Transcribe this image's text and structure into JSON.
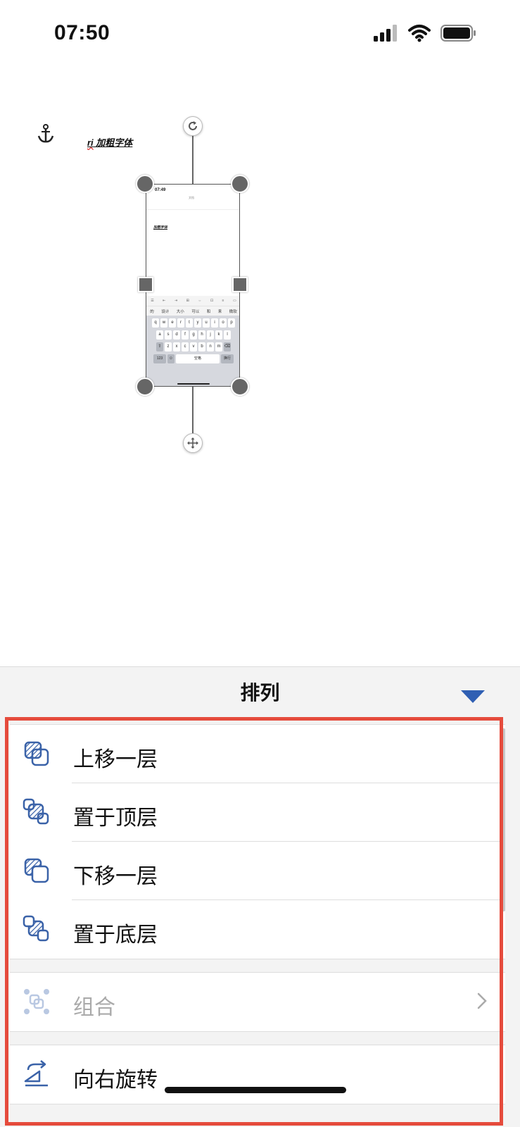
{
  "status_bar": {
    "time": "07:50"
  },
  "canvas": {
    "doc_text_prefix": "ri",
    "doc_text_main": "加粗字体"
  },
  "embedded_screenshot": {
    "time": "07:49",
    "title": "文档",
    "doc_text": "加粗字体",
    "candidates": [
      "的",
      "设计",
      "大小",
      "可以",
      "和",
      "来",
      "微软"
    ],
    "row1": [
      "q",
      "w",
      "e",
      "r",
      "t",
      "y",
      "u",
      "i",
      "o",
      "p"
    ],
    "row2": [
      "a",
      "s",
      "d",
      "f",
      "g",
      "h",
      "j",
      "k",
      "l"
    ],
    "row3": [
      "z",
      "x",
      "c",
      "v",
      "b",
      "n",
      "m"
    ],
    "num_key": "123",
    "space_key": "空格",
    "return_key": "换行"
  },
  "sheet": {
    "title": "排列",
    "items": [
      {
        "label": "上移一层",
        "icon": "bring-forward-icon",
        "enabled": true
      },
      {
        "label": "置于顶层",
        "icon": "bring-to-front-icon",
        "enabled": true
      },
      {
        "label": "下移一层",
        "icon": "send-backward-icon",
        "enabled": true
      },
      {
        "label": "置于底层",
        "icon": "send-to-back-icon",
        "enabled": true
      }
    ],
    "group_item": {
      "label": "组合",
      "icon": "group-icon",
      "enabled": false
    },
    "rotate_item": {
      "label": "向右旋转",
      "icon": "rotate-right-icon",
      "enabled": true
    }
  },
  "colors": {
    "accent": "#2f5fb3",
    "highlight_border": "#e54b3c",
    "icon_blue": "#3a62a8"
  }
}
